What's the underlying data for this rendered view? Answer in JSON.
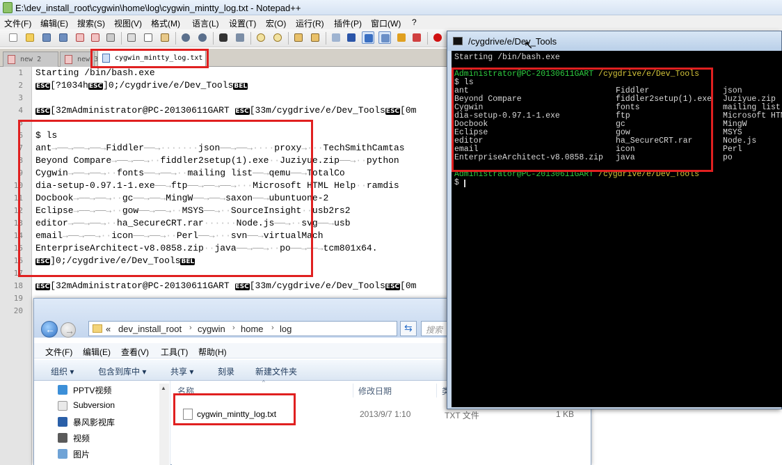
{
  "npp": {
    "title": "E:\\dev_install_root\\cygwin\\home\\log\\cygwin_mintty_log.txt - Notepad++",
    "menu": [
      "文件(F)",
      "编辑(E)",
      "搜索(S)",
      "视图(V)",
      "格式(M)",
      "语言(L)",
      "设置(T)",
      "宏(O)",
      "运行(R)",
      "插件(P)",
      "窗口(W)",
      "?"
    ],
    "tabs": [
      {
        "label": "new  2",
        "active": false
      },
      {
        "label": "new  3",
        "active": false
      },
      {
        "label": "cygwin_mintty_log.txt",
        "active": true
      }
    ],
    "line_numbers": [
      "1",
      "2",
      "3",
      "4",
      "5",
      "6",
      "7",
      "8",
      "9",
      "10",
      "11",
      "12",
      "13",
      "14",
      "15",
      "16",
      "17",
      "18",
      "19",
      "20"
    ],
    "esc_label": "ESC",
    "bel_label": "BEL",
    "lines": {
      "l1": "Starting /bin/bash.exe",
      "l2a": "[?1034h",
      "l2b": "]0;/cygdrive/e/Dev_Tools",
      "l4a": "[32mAdministrator@PC-20130611GART ",
      "l4b": "[33m/cygdrive/e/Dev_Tools",
      "l4c": "[0m",
      "l5": "$ ls",
      "l6": [
        "ant",
        "Fiddler",
        "json",
        "proxy",
        "TechSmithCamtas"
      ],
      "l7": [
        "Beyond Compare",
        "fiddler2setup(1).exe",
        "Juziyue.zip",
        "python"
      ],
      "l8": [
        "Cygwin",
        "fonts",
        "mailing list",
        "qemu",
        "TotalCo"
      ],
      "l9": [
        "dia-setup-0.97.1-1.exe",
        "ftp",
        "Microsoft HTML Help",
        "ramdis"
      ],
      "l10": [
        "Docbook",
        "gc",
        "MingW",
        "saxon",
        "ubuntuone-2"
      ],
      "l11": [
        "Eclipse",
        "gow",
        "MSYS",
        "SourceInsight",
        "usb2rs2"
      ],
      "l12": [
        "editor",
        "ha_SecureCRT.rar",
        "Node.js",
        "svg",
        "usb"
      ],
      "l13": [
        "email",
        "icon",
        "Perl",
        "svn",
        "virtualMach"
      ],
      "l14": [
        "EnterpriseArchitect-v8.0858.zip",
        "java",
        "po",
        "tcm801x64."
      ],
      "l15": "]0;/cygdrive/e/Dev_Tools",
      "l17a": "[32mAdministrator@PC-20130611GART ",
      "l17b": "[33m/cygdrive/e/Dev_Tools",
      "l17c": "[0m"
    }
  },
  "explorer": {
    "address": [
      "«",
      "dev_install_root",
      "cygwin",
      "home",
      "log"
    ],
    "search_placeholder": "搜索",
    "menu": [
      "文件(F)",
      "编辑(E)",
      "查看(V)",
      "工具(T)",
      "帮助(H)"
    ],
    "commands": [
      "组织 ▾",
      "包含到库中 ▾",
      "共享 ▾",
      "刻录",
      "新建文件夹"
    ],
    "nav_items": [
      {
        "label": "PPTV视频",
        "color": "#3c8fd8"
      },
      {
        "label": "Subversion",
        "color": "#e9e9e9"
      },
      {
        "label": "暴风影视库",
        "color": "#2a5fa8"
      },
      {
        "label": "视频",
        "color": "#5a5a5a"
      },
      {
        "label": "图片",
        "color": "#6fa3d6"
      }
    ],
    "columns": [
      "名称",
      "修改日期",
      "类"
    ],
    "file": {
      "name": "cygwin_mintty_log.txt",
      "date": "2013/9/7 1:10",
      "type": "TXT 文件",
      "size": "1 KB"
    }
  },
  "terminal": {
    "title": "/cygdrive/e/Dev_Tools",
    "line_start": "Starting /bin/bash.exe",
    "prompt_user": "Administrator@PC-20130611GART ",
    "prompt_path": "/cygdrive/e/Dev_Tools",
    "cmd": "$ ls",
    "col1": [
      "ant",
      "Beyond Compare",
      "Cygwin",
      "dia-setup-0.97.1-1.exe",
      "Docbook",
      "Eclipse",
      "editor",
      "email",
      "EnterpriseArchitect-v8.0858.zip"
    ],
    "col2": [
      "Fiddler",
      "fiddler2setup(1).exe",
      "fonts",
      "ftp",
      "gc",
      "gow",
      "ha_SecureCRT.rar",
      "icon",
      "java"
    ],
    "col3": [
      "json",
      "Juziyue.zip",
      "mailing list",
      "Microsoft HTM",
      "MingW",
      "MSYS",
      "Node.js",
      "Perl",
      "po"
    ],
    "prompt_end": "$ "
  }
}
